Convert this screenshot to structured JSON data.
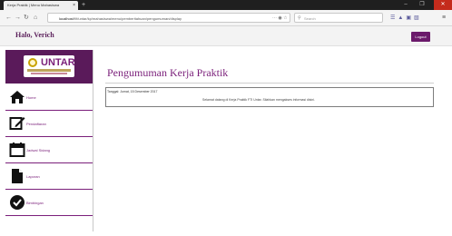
{
  "browser": {
    "tab_title": "Kerja Praktik | Menu Mahasiswa",
    "tab_close": "×",
    "new_tab": "+",
    "url_host": "localhost",
    "url_path": "/f/f/untar/kp/mahasiswa/menu/pemberitahuan/pengumuman/display",
    "search_placeholder": "Search",
    "window_controls": [
      "–",
      "❐",
      "✕"
    ],
    "toolbar_icons": [
      "library-icon",
      "sync-icon",
      "reader-icon",
      "screenshot-icon",
      "menu-icon"
    ]
  },
  "header": {
    "greeting": "Halo, Verich",
    "logout_label": "Logout"
  },
  "logo": {
    "text": "UNTAR"
  },
  "sidebar": {
    "items": [
      {
        "label": "Home",
        "icon": "home-icon"
      },
      {
        "label": "Pendaftaran",
        "icon": "edit-icon"
      },
      {
        "label": "Jadwal Sidang",
        "icon": "calendar-icon"
      },
      {
        "label": "Laporan",
        "icon": "document-icon"
      },
      {
        "label": "Bimbingan",
        "icon": "check-circle-icon"
      }
    ]
  },
  "main": {
    "title": "Pengumuman Kerja Praktik",
    "announcement": {
      "date": "Tanggal: Jumat, 15 Desember 2017",
      "message": "Selamat datang di Kerja Praktik FTI Untar. Silahkan mengakses informasi disini."
    }
  },
  "colors": {
    "brand": "#6b1a6b",
    "accent_text": "#7a1f7a"
  }
}
